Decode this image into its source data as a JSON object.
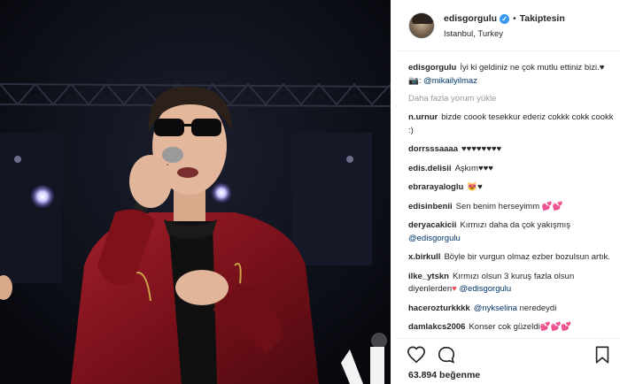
{
  "post": {
    "username": "edisgorgulu",
    "separator": "•",
    "follow_label": "Takiptesin",
    "location": "Istanbul, Turkey"
  },
  "caption": {
    "user": "edisgorgulu",
    "text": "İyi ki geldiniz ne çok mutlu ettiniz bizi.♥ 📷: ",
    "mention": "@mikailyilmaz"
  },
  "load_more": "Daha fazla yorum yükle",
  "comments": [
    {
      "user": "n.urnur",
      "text": "bizde coook tesekkur ederiz cokkk cokk cookk :)"
    },
    {
      "user": "dorrsssaaaa",
      "text": "♥♥♥♥♥♥♥♥"
    },
    {
      "user": "edis.delisii",
      "text": "Aşkım♥♥♥"
    },
    {
      "user": "ebrarayaloglu",
      "text": "😻♥"
    },
    {
      "user": "edisinbenii",
      "text": "Sen benim herseyimm ",
      "hearts": "💕💕"
    },
    {
      "user": "deryacakicii",
      "text": "Kırmızı daha da çok yakışmış ",
      "mention": "@edisgorgulu"
    },
    {
      "user": "x.birkull",
      "text": "Böyle bir vurgun olmaz ezber bozulsun artık."
    },
    {
      "user": "ilke_ytskn",
      "text": "Kırmızı olsun 3 kuruş fazla olsun diyenlerden",
      "hearts": "♥",
      "mention": " @edisgorgulu"
    },
    {
      "user": "hacerozturkkkk",
      "text": " neredeydi",
      "mention_first": "@nykselina"
    },
    {
      "user": "damlakcs2006",
      "text": "Konser cok güzeldi",
      "hearts": "💕💕💕"
    }
  ],
  "likes": "63.894 beğenme",
  "icons": {
    "like": "heart-outline-icon",
    "comment": "speech-bubble-icon",
    "save": "bookmark-icon"
  },
  "colors": {
    "link": "#003569",
    "verified": "#3897f0",
    "muted": "#999999",
    "jacket": "#8b1620"
  }
}
